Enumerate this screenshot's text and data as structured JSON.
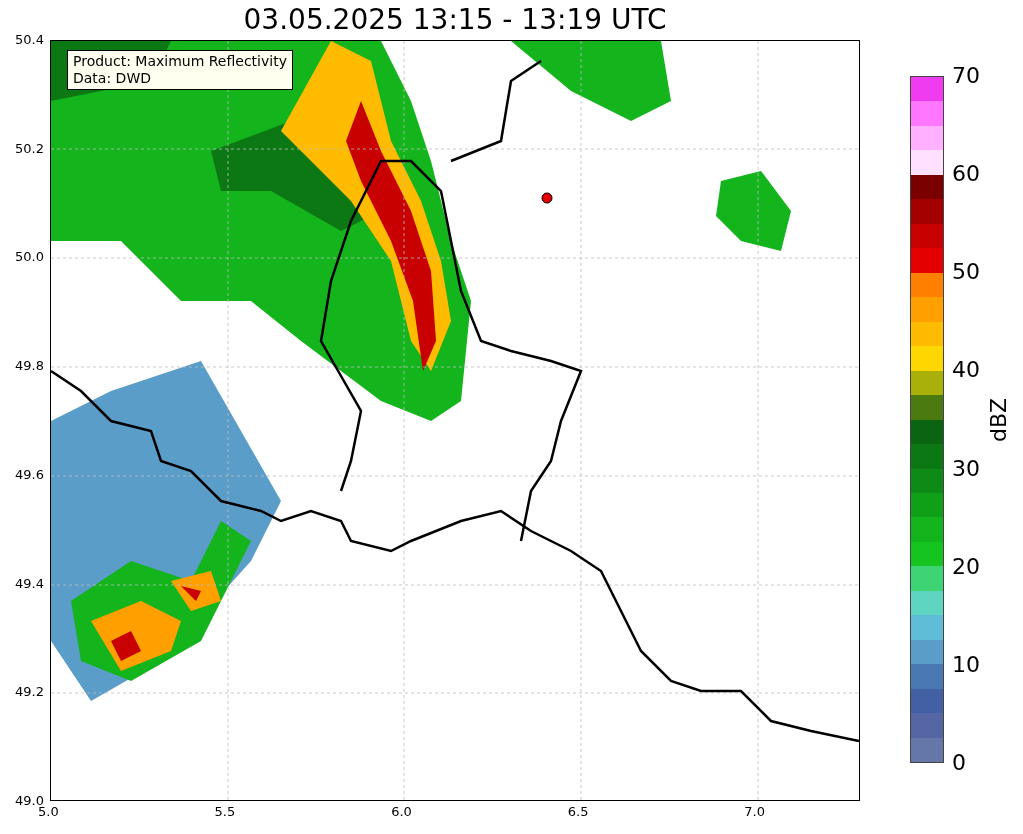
{
  "title": "03.05.2025 13:15 - 13:19 UTC",
  "legend": {
    "lines": [
      "Product: Maximum Reflectivity",
      "Data: DWD"
    ]
  },
  "y_axis": {
    "ticks": [
      "50.4",
      "50.2",
      "50.0",
      "49.8",
      "49.6",
      "49.4",
      "49.2",
      "49.0"
    ]
  },
  "x_axis": {
    "ticks": [
      "5.0",
      "5.5",
      "6.0",
      "6.5",
      "7.0"
    ]
  },
  "colorbar": {
    "label": "dBZ",
    "ticks": [
      "70",
      "60",
      "50",
      "40",
      "30",
      "20",
      "10",
      "0"
    ],
    "segments": [
      {
        "color": "#6577a8"
      },
      {
        "color": "#5566a5"
      },
      {
        "color": "#4460a4"
      },
      {
        "color": "#4a78b2"
      },
      {
        "color": "#5a9dc8"
      },
      {
        "color": "#60bdd8"
      },
      {
        "color": "#5dd5c0"
      },
      {
        "color": "#3ed474"
      },
      {
        "color": "#16c420"
      },
      {
        "color": "#14b41c"
      },
      {
        "color": "#10a018"
      },
      {
        "color": "#0e8a16"
      },
      {
        "color": "#0c7814"
      },
      {
        "color": "#0a6412"
      },
      {
        "color": "#4a7a10"
      },
      {
        "color": "#aab00a"
      },
      {
        "color": "#ffd700"
      },
      {
        "color": "#ffbb00"
      },
      {
        "color": "#ff9f00"
      },
      {
        "color": "#ff7f00"
      },
      {
        "color": "#e40000"
      },
      {
        "color": "#c80000"
      },
      {
        "color": "#a50000"
      },
      {
        "color": "#7a0000"
      },
      {
        "color": "#ffe0ff"
      },
      {
        "color": "#ffb0ff"
      },
      {
        "color": "#ff77ff"
      },
      {
        "color": "#f03cf0"
      }
    ]
  }
}
